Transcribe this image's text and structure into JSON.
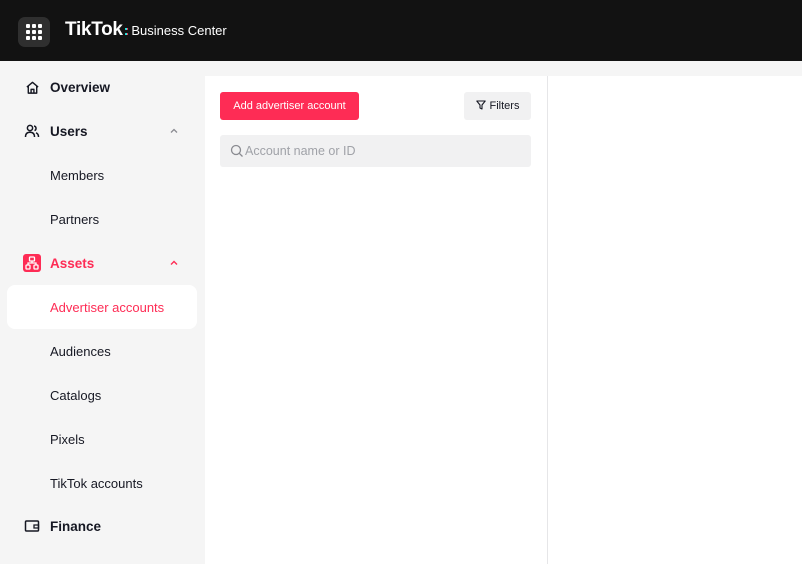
{
  "header": {
    "logo_main": "TikTok",
    "logo_colon": ":",
    "logo_sub": "Business Center"
  },
  "sidebar": {
    "overview": "Overview",
    "users": "Users",
    "members": "Members",
    "partners": "Partners",
    "assets": "Assets",
    "advertiser_accounts": "Advertiser accounts",
    "audiences": "Audiences",
    "catalogs": "Catalogs",
    "pixels": "Pixels",
    "tiktok_accounts": "TikTok accounts",
    "finance": "Finance"
  },
  "main": {
    "add_button_label": "Add advertiser account",
    "filters_label": "Filters",
    "search_placeholder": "Account name or ID",
    "search_value": ""
  },
  "colors": {
    "accent": "#fe2c55",
    "topbar": "#121212",
    "sidebar_bg": "#f5f5f5"
  }
}
